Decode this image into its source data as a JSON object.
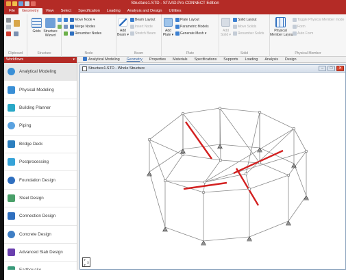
{
  "app": {
    "title": "Structure1.STD - STAAD.Pro CONNECT Edition",
    "accent": "#b42b26"
  },
  "ribbon_tabs": [
    "File",
    "Geometry",
    "View",
    "Select",
    "Specification",
    "Loading",
    "Analysis and Design",
    "Utilities"
  ],
  "ribbon": {
    "clipboard": {
      "label": "Clipboard"
    },
    "structure": {
      "label": "Structure",
      "grids": "Grids",
      "wizard_line1": "Structure",
      "wizard_line2": "Wizard"
    },
    "node": {
      "label": "Node",
      "move_nodes": "Move Node ▾",
      "merge_nodes": "Merge Nodes",
      "renumber_nodes": "Renumber Nodes"
    },
    "beam": {
      "label": "Beam",
      "add_beam_line1": "Add",
      "add_beam_line2": "Beam ▾",
      "beam_layout": "Beam Layout",
      "insert_node": "Insert Node",
      "stretch_beam": "Stretch Beam"
    },
    "plate": {
      "label": "Plate",
      "add_plate_line1": "Add",
      "add_plate_line2": "Plate ▾",
      "plate_layout": "Plate Layout",
      "parametric_models": "Parametric Models",
      "generate_mesh": "Generate Mesh ▾"
    },
    "solid": {
      "label": "Solid",
      "add_solid_line1": "Add",
      "add_solid_line2": "Solid ▾",
      "solid_layout": "Solid Layout",
      "move_solids": "Move Solids",
      "renumber_solids": "Renumber Solids"
    },
    "physical_member": {
      "label": "Physical Member",
      "layout_line1": "Physical",
      "layout_line2": "Member Layout",
      "toggle": "Toggle Physical Member mode",
      "form": "Form",
      "auto_form": "Auto Form"
    }
  },
  "workflows": {
    "header": "Workflows",
    "items": [
      {
        "label": "Analytical Modeling",
        "color": "#3a8fd6",
        "active": true
      },
      {
        "label": "Physical Modeling",
        "color": "#3a8fd6"
      },
      {
        "label": "Building Planner",
        "color": "#29a8c7"
      },
      {
        "label": "Piping",
        "color": "#5aa2e0"
      },
      {
        "label": "Bridge Deck",
        "color": "#2c7fbf"
      },
      {
        "label": "Postprocessing",
        "color": "#36a3d8"
      },
      {
        "label": "Foundation Design",
        "color": "#2f6fbf"
      },
      {
        "label": "Steel Design",
        "color": "#4aa06a"
      },
      {
        "label": "Connection Design",
        "color": "#2f6fbf"
      },
      {
        "label": "Concrete Design",
        "color": "#3f7ec4"
      },
      {
        "label": "Advanced Slab Design",
        "color": "#6a3fae"
      },
      {
        "label": "Earthquake",
        "color": "#3a9a7a"
      }
    ]
  },
  "page_tabs": [
    "Analytical Modeling",
    "Geometry",
    "Properties",
    "Materials",
    "Specifications",
    "Supports",
    "Loading",
    "Analysis",
    "Design"
  ],
  "viewport": {
    "title": "Structure1.STD - Whole Structure",
    "minimize": "–",
    "restore": "□",
    "close": "✕",
    "axis_y": "Y",
    "axis_x": "X",
    "axis_z": "Z"
  }
}
